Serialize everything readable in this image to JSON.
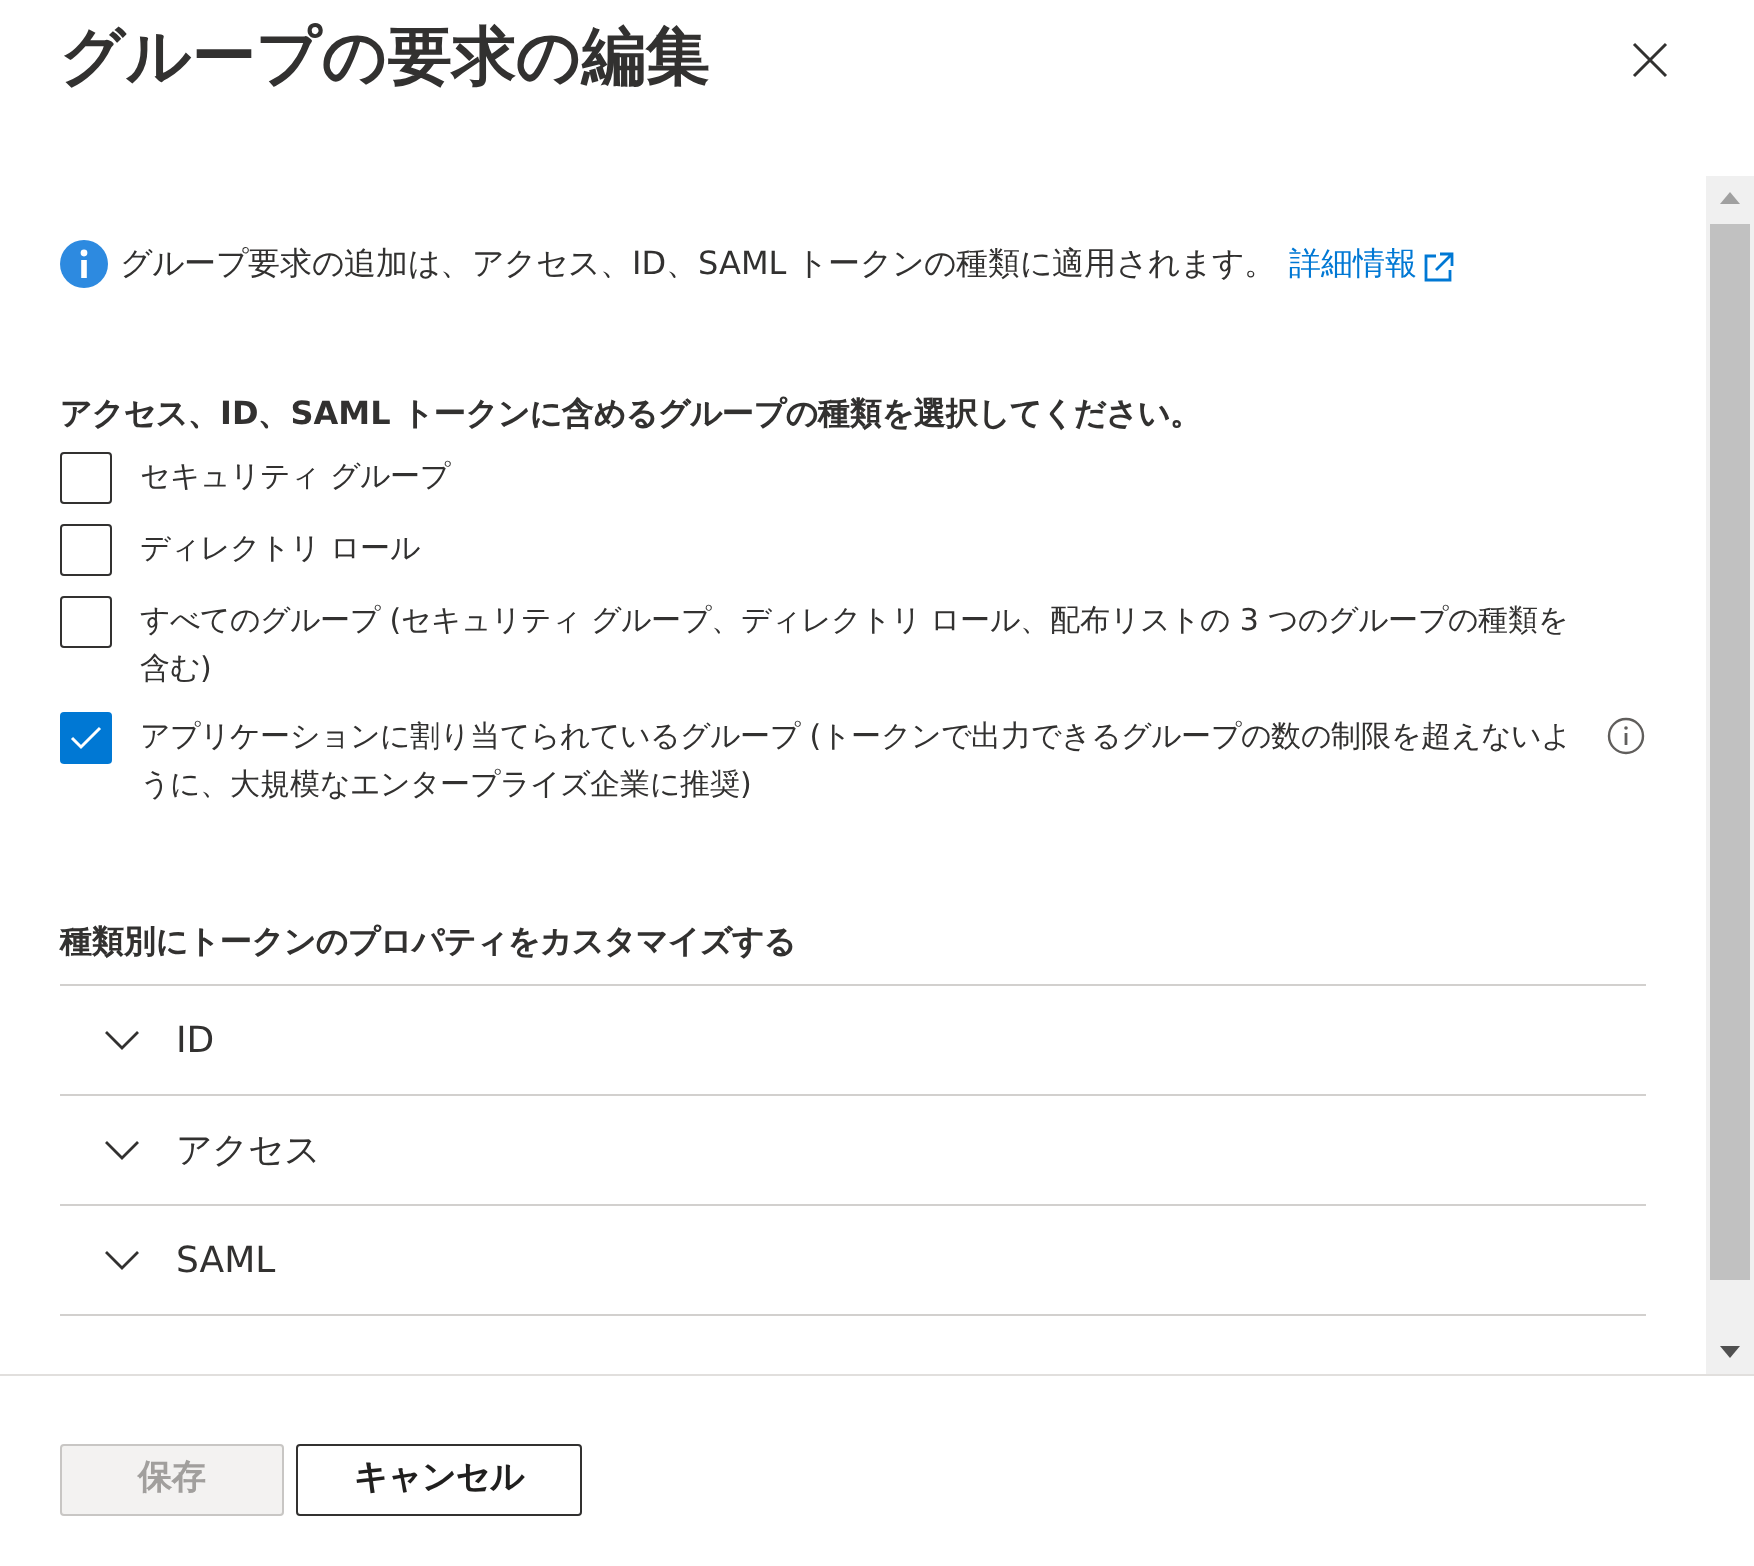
{
  "title": "グループの要求の編集",
  "info": {
    "text": "グループ要求の追加は、アクセス、ID、SAML トークンの種類に適用されます。",
    "link": "詳細情報"
  },
  "group_types": {
    "label": "アクセス、ID、SAML トークンに含めるグループの種類を選択してください。",
    "options": [
      {
        "label": "セキュリティ グループ",
        "checked": false,
        "info": false
      },
      {
        "label": "ディレクトリ ロール",
        "checked": false,
        "info": false
      },
      {
        "label": "すべてのグループ (セキュリティ グループ、ディレクトリ ロール、配布リストの 3 つのグループの種類を含む)",
        "checked": false,
        "info": false
      },
      {
        "label": "アプリケーションに割り当てられているグループ (トークンで出力できるグループの数の制限を超えないように、大規模なエンタープライズ企業に推奨)",
        "checked": true,
        "info": true
      }
    ]
  },
  "customize": {
    "label": "種類別にトークンのプロパティをカスタマイズする",
    "sections": [
      {
        "label": "ID",
        "expanded": false
      },
      {
        "label": "アクセス",
        "expanded": false
      },
      {
        "label": "SAML",
        "expanded": false
      }
    ]
  },
  "buttons": [
    {
      "label": "保存",
      "disabled": true
    },
    {
      "label": "キャンセル",
      "disabled": false
    }
  ]
}
